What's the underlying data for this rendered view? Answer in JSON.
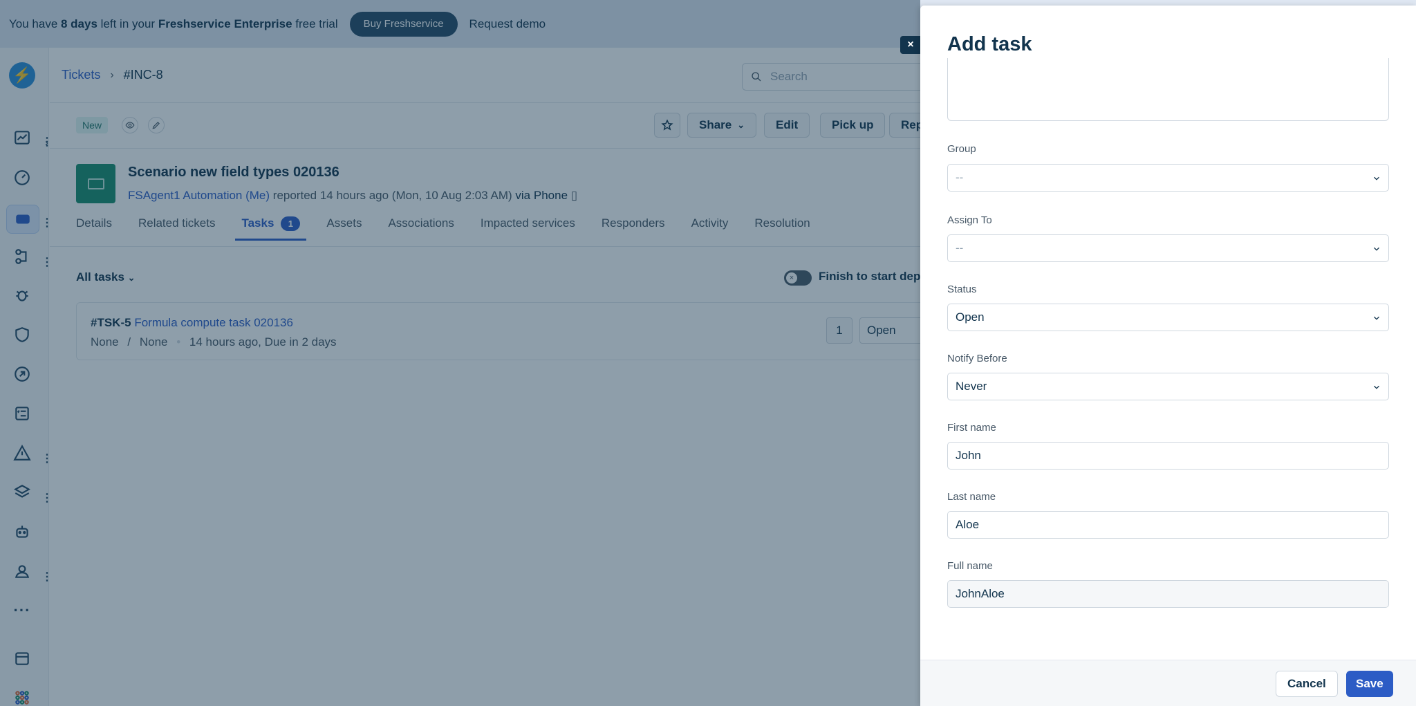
{
  "banner": {
    "text_prefix": "You have ",
    "days": "8 days",
    "text_middle": " left in your ",
    "product": "Freshservice Enterprise",
    "text_suffix": " free trial",
    "buy_label": "Buy Freshservice",
    "demo_label": "Request demo"
  },
  "header": {
    "breadcrumb_root": "Tickets",
    "breadcrumb_current": "#INC-8",
    "search_placeholder": "Search"
  },
  "toolbar": {
    "status_badge": "New",
    "share_label": "Share",
    "edit_label": "Edit",
    "pickup_label": "Pick up",
    "reply_label": "Rep"
  },
  "ticket": {
    "title": "Scenario new field types 020136",
    "agent": "FSAgent1 Automation (Me)",
    "reported": "reported 14 hours ago (Mon, 10 Aug 2:03 AM)",
    "via": "via Phone"
  },
  "tabs": [
    {
      "label": "Details"
    },
    {
      "label": "Related tickets"
    },
    {
      "label": "Tasks",
      "count": "1"
    },
    {
      "label": "Assets"
    },
    {
      "label": "Associations"
    },
    {
      "label": "Impacted services"
    },
    {
      "label": "Responders"
    },
    {
      "label": "Activity"
    },
    {
      "label": "Resolution"
    }
  ],
  "tasks_view": {
    "filter_label": "All tasks",
    "toggle_label": "Finish to start depe",
    "task": {
      "id": "#TSK-5",
      "title": "Formula compute task 020136",
      "meta_a": "None",
      "meta_sep": "/",
      "meta_b": "None",
      "meta_time": "14 hours ago, Due in 2 days",
      "number": "1",
      "status": "Open"
    }
  },
  "drawer": {
    "title": "Add task",
    "fields": {
      "group": {
        "label": "Group",
        "value": "--"
      },
      "assign_to": {
        "label": "Assign To",
        "value": "--"
      },
      "status": {
        "label": "Status",
        "value": "Open"
      },
      "notify_before": {
        "label": "Notify Before",
        "value": "Never"
      },
      "first_name": {
        "label": "First name",
        "value": "John"
      },
      "last_name": {
        "label": "Last name",
        "value": "Aloe"
      },
      "full_name": {
        "label": "Full name",
        "value": "JohnAloe"
      }
    },
    "cancel_label": "Cancel",
    "save_label": "Save",
    "close_glyph": "×"
  },
  "colors": {
    "brand_blue": "#2c5cc5",
    "text_dark": "#12344d",
    "ticket_icon_green": "#188c6c",
    "banner_bg": "#dfe7f2"
  }
}
